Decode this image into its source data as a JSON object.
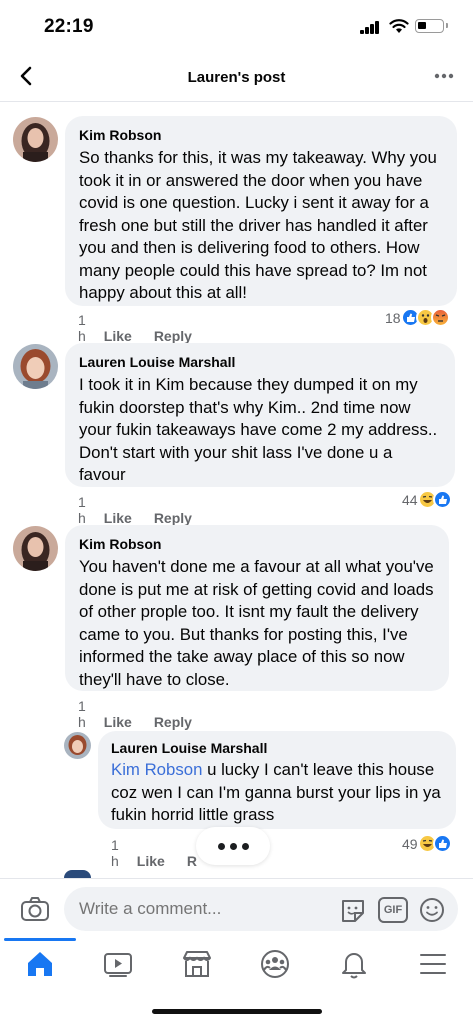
{
  "status_bar": {
    "time": "22:19"
  },
  "header": {
    "title": "Lauren's post",
    "back_icon": "chevron-left-icon",
    "more_icon": "more-dots-icon"
  },
  "comments": [
    {
      "author": "Kim Robson",
      "text": "So thanks for this, it was my takeaway. Why you took it in or answered the door when you have covid is one question. Lucky i sent it away for a fresh one but still the driver has handled it after you and then is delivering food to others. How many people could this have spread to? Im not happy about this at all!",
      "time": "1 h",
      "like_label": "Like",
      "reply_label": "Reply",
      "reaction_count": "18",
      "reactions": [
        "like",
        "wow",
        "angry"
      ]
    },
    {
      "author": "Lauren Louise Marshall",
      "text": "I took it in Kim because they dumped it on my fukin doorstep that's why Kim.. 2nd time now your fukin takeaways have come 2 my address.. Don't start with your shit lass I've done u a favour",
      "time": "1 h",
      "like_label": "Like",
      "reply_label": "Reply",
      "reaction_count": "44",
      "reactions": [
        "haha",
        "like"
      ]
    },
    {
      "author": "Kim Robson",
      "text": "You haven't done me a favour at all what you've done is put me at risk of getting covid and loads of other prople too. It isnt my fault the delivery came to you. But thanks for posting this, I've informed the take away place of this so now they'll have to close.",
      "time": "1 h",
      "like_label": "Like",
      "reply_label": "Reply"
    },
    {
      "author": "Lauren Louise Marshall",
      "mention": "Kim Robson",
      "text": " u lucky I can't leave this house coz wen I can I'm ganna burst your lips in ya fukin horrid little grass",
      "time": "1 h",
      "like_label": "Like",
      "reply_label": "R",
      "reaction_count": "49",
      "reactions": [
        "haha",
        "like"
      ]
    }
  ],
  "compose": {
    "placeholder": "Write a comment...",
    "gif_label": "GIF",
    "icons": [
      "camera-icon",
      "sticker-icon",
      "gif-icon",
      "emoji-icon"
    ]
  },
  "bottom_nav": {
    "items": [
      "home-icon",
      "watch-icon",
      "marketplace-icon",
      "groups-icon",
      "notifications-icon",
      "menu-icon"
    ],
    "active": "home-icon"
  },
  "colors": {
    "accent": "#1877f2",
    "bubble": "#f0f2f5",
    "secondary_text": "#65676b",
    "mention": "#3b6fd8"
  }
}
